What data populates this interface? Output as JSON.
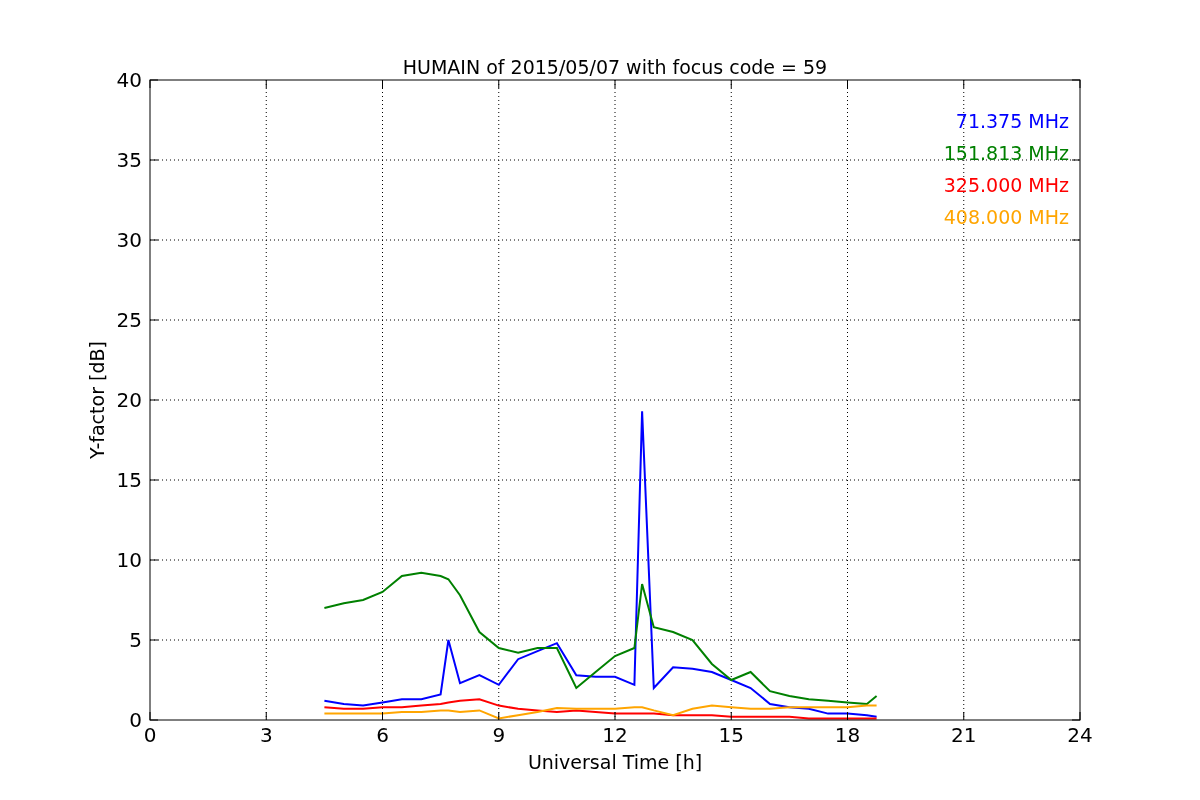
{
  "plot": {
    "chart_data": {
      "type": "line",
      "title": "HUMAIN of 2015/05/07 with focus code = 59",
      "xlabel": "Universal Time [h]",
      "ylabel": "Y-factor [dB]",
      "x": [
        4.5,
        5,
        5.5,
        6,
        6.5,
        7,
        7.5,
        7.7,
        8,
        8.5,
        9,
        9.5,
        10,
        10.5,
        11,
        11.5,
        12,
        12.5,
        12.7,
        13,
        13.5,
        14,
        14.5,
        15,
        15.5,
        16,
        16.5,
        17,
        17.5,
        18,
        18.5,
        18.75
      ],
      "series": [
        {
          "name": "71.375 MHz",
          "color": "#0000ff",
          "values": [
            1.2,
            1.0,
            0.9,
            1.1,
            1.3,
            1.3,
            1.6,
            5.0,
            2.3,
            2.8,
            2.2,
            3.8,
            4.3,
            4.8,
            2.8,
            2.7,
            2.7,
            2.2,
            19.3,
            2.0,
            3.3,
            3.2,
            3.0,
            2.5,
            2.0,
            1.0,
            0.8,
            0.7,
            0.4,
            0.4,
            0.3,
            0.2
          ]
        },
        {
          "name": "151.813 MHz",
          "color": "#008000",
          "values": [
            7.0,
            7.3,
            7.5,
            8.0,
            9.0,
            9.2,
            9.0,
            8.8,
            7.8,
            5.5,
            4.5,
            4.2,
            4.5,
            4.5,
            2.0,
            3.0,
            4.0,
            4.5,
            8.5,
            5.8,
            5.5,
            5.0,
            3.5,
            2.5,
            3.0,
            1.8,
            1.5,
            1.3,
            1.2,
            1.1,
            1.0,
            1.5
          ]
        },
        {
          "name": "325.000 MHz",
          "color": "#ff0000",
          "values": [
            0.8,
            0.7,
            0.7,
            0.8,
            0.8,
            0.9,
            1.0,
            1.1,
            1.2,
            1.3,
            0.9,
            0.7,
            0.6,
            0.5,
            0.6,
            0.5,
            0.4,
            0.4,
            0.4,
            0.4,
            0.3,
            0.3,
            0.3,
            0.2,
            0.2,
            0.2,
            0.2,
            0.1,
            0.1,
            0.1,
            0.1,
            0.1
          ]
        },
        {
          "name": "408.000 MHz",
          "color": "#ffa500",
          "values": [
            0.4,
            0.4,
            0.4,
            0.4,
            0.5,
            0.5,
            0.6,
            0.6,
            0.5,
            0.6,
            0.1,
            0.3,
            0.5,
            0.75,
            0.7,
            0.7,
            0.7,
            0.8,
            0.8,
            0.6,
            0.3,
            0.7,
            0.9,
            0.8,
            0.7,
            0.7,
            0.8,
            0.8,
            0.8,
            0.8,
            0.9,
            0.9
          ]
        }
      ],
      "xlim": [
        0,
        24
      ],
      "ylim": [
        0,
        40
      ],
      "xticks": [
        0,
        3,
        6,
        9,
        12,
        15,
        18,
        21,
        24
      ],
      "yticks": [
        0,
        5,
        10,
        15,
        20,
        25,
        30,
        35,
        40
      ],
      "grid": true
    }
  }
}
